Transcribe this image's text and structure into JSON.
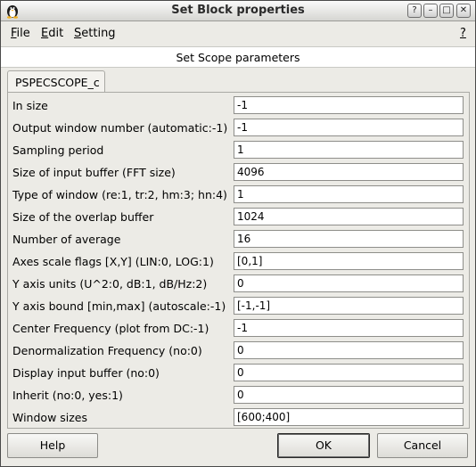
{
  "window": {
    "title": "Set Block properties"
  },
  "window_buttons": {
    "help": "?",
    "minimize": "–",
    "maximize": "□",
    "close": "✕"
  },
  "menu": {
    "items": [
      {
        "u": "F",
        "rest": "ile"
      },
      {
        "u": "E",
        "rest": "dit"
      },
      {
        "u": "S",
        "rest": "etting"
      }
    ],
    "help_u": "?"
  },
  "header": "Set Scope parameters",
  "tab": "PSPECSCOPE_c",
  "fields": [
    {
      "label": "In size",
      "value": "-1"
    },
    {
      "label": "Output window number (automatic:-1)",
      "value": "-1"
    },
    {
      "label": "Sampling period",
      "value": "1"
    },
    {
      "label": "Size of input buffer (FFT size)",
      "value": "4096"
    },
    {
      "label": "Type of window (re:1, tr:2, hm:3; hn:4)",
      "value": "1"
    },
    {
      "label": "Size of the overlap buffer",
      "value": "1024"
    },
    {
      "label": "Number of average",
      "value": "16"
    },
    {
      "label": "Axes scale flags [X,Y] (LIN:0, LOG:1)",
      "value": "[0,1]"
    },
    {
      "label": "Y axis units (U^2:0, dB:1, dB/Hz:2)",
      "value": "0"
    },
    {
      "label": "Y axis bound [min,max] (autoscale:-1)",
      "value": "[-1,-1]"
    },
    {
      "label": "Center Frequency (plot from DC:-1)",
      "value": "-1"
    },
    {
      "label": "Denormalization Frequency (no:0)",
      "value": "0"
    },
    {
      "label": "Display input buffer (no:0)",
      "value": "0"
    },
    {
      "label": "Inherit (no:0, yes:1)",
      "value": "0"
    },
    {
      "label": "Window sizes",
      "value": "[600;400]"
    }
  ],
  "buttons": {
    "help": "Help",
    "ok": "OK",
    "cancel": "Cancel"
  }
}
